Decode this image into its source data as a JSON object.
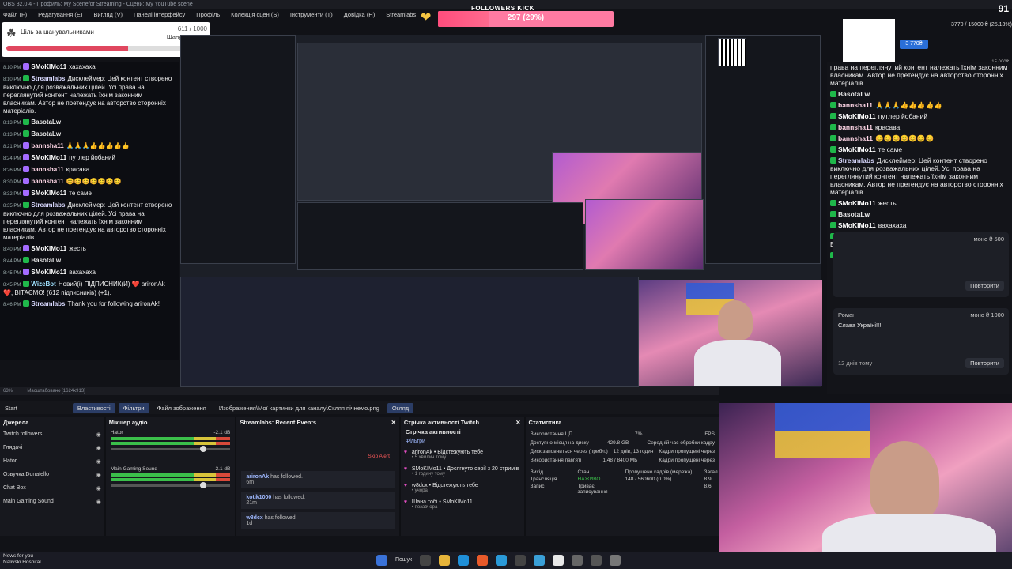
{
  "obs": {
    "title": "OBS 32.0.4 - Профиль: My Scenefor Streaming - Сцени: My YouTube scene",
    "menu": [
      "Файл (F)",
      "Редагування (E)",
      "Вигляд (V)",
      "Панелі інтерфейсу",
      "Профіль",
      "Колекція сцен (S)",
      "Інструменти (T)",
      "Довідка (H)",
      "Streamlabs"
    ],
    "status_left": "63%",
    "status_scale": "Масштабовано [1624x913]",
    "toolbar": {
      "start": "Start",
      "properties": "Властивості",
      "filters": "Фільтри",
      "image_file": "Файл зображення",
      "path": "Изображения\\Мої картинки для каналу\\Скляп пічнемо.png",
      "view": "Огляд"
    },
    "sources": {
      "title": "Джерела",
      "items": [
        "Twitch followers",
        "Глядачі",
        "Hator",
        "Озвучка Donatello",
        "Chat Box",
        "Main Gaming Sound"
      ]
    },
    "mixer": {
      "title": "Мікшер аудіо",
      "channels": [
        {
          "name": "Hator",
          "db": "-2.1 dB",
          "level": 0.75
        },
        {
          "name": "Main Gaming Sound",
          "db": "-2.1 dB",
          "level": 0.75
        }
      ]
    },
    "recent_events": {
      "title": "Streamlabs: Recent Events",
      "skip": "Skip Alert",
      "items": [
        {
          "name": "arironAk",
          "text": "has followed.",
          "ago": "6m"
        },
        {
          "name": "kotik1000",
          "text": "has followed.",
          "ago": "21m"
        },
        {
          "name": "w8dcx",
          "text": "has followed.",
          "ago": "1d"
        }
      ]
    },
    "activity": {
      "title": "Стрічка активності Twitch",
      "subtitle": "Стрічка активності",
      "filters": "Фільтри",
      "items": [
        {
          "text": "arironAk • Відстежують тебе",
          "sub": "• 5 хвилин тому"
        },
        {
          "text": "SMoKIMo11 • Досягнуто серії з 20 стримів",
          "sub": "• 1 годину тому"
        },
        {
          "text": "w8dcx • Відстежують тебе",
          "sub": "• учора"
        },
        {
          "text": "Шана тобі • SMoKIMo11",
          "sub": "• позавчора"
        }
      ]
    },
    "stats": {
      "title": "Статистика",
      "rows": [
        {
          "k": "Використання ЦП",
          "v": "7%",
          "k2": "FPS"
        },
        {
          "k": "Доступно місця на диску",
          "v": "429.8 GB",
          "k2": "Середній час обробки кадру"
        },
        {
          "k": "Диск заповниться через (прибл.)",
          "v": "12 днів, 13 годин",
          "k2": "Кадри пропущені через"
        },
        {
          "k": "Використання пам'яті",
          "v": "1.48 / 8400 МБ",
          "k2": "Кадри пропущені через"
        }
      ],
      "grid_headers": [
        "Вихід",
        "Стан",
        "Пропущено кадрів (мережа)",
        "Загал"
      ],
      "grid_rows": [
        [
          "Трансляція",
          "НАЖИВО",
          "148 / 560600 (0.0%)",
          "8.9"
        ],
        [
          "Запис",
          "Триває записування",
          "",
          "8.6"
        ]
      ]
    }
  },
  "goal": {
    "title": "Ціль за шанувальниками",
    "count": "611 / 1000",
    "sub": "Шанувальники",
    "progress": 0.611
  },
  "kick": {
    "label": "FOLLOWERS KICK",
    "value": "297 (29%)",
    "progress": 0.29
  },
  "donate": {
    "text": "3770 / 15000 ₴ (25.13%)",
    "button": "3 770₴",
    "max": "15 000₴",
    "score": "91"
  },
  "chat_left": [
    {
      "time": "8:10 PM",
      "name": "SMoKIMo11",
      "cls": "smo",
      "badge": "p",
      "text": "хахахаха"
    },
    {
      "time": "8:10 PM",
      "name": "Streamlabs",
      "cls": "sl",
      "badge": "g",
      "text": "Дисклеймер: Цей контент створено виключно для розважальних цілей. Усі права на переглянутий контент належать їхнім законним власникам. Автор не претендує на авторство сторонніх матеріалів."
    },
    {
      "time": "8:13 PM",
      "name": "BasotaLw",
      "cls": "basota",
      "badge": "g",
      "text": ""
    },
    {
      "time": "8:13 PM",
      "name": "BasotaLw",
      "cls": "basota",
      "badge": "g",
      "text": ""
    },
    {
      "time": "8:21 PM",
      "name": "bannsha11",
      "cls": "bann",
      "badge": "p",
      "text": "🙏🙏🙏👍👍👍👍👍"
    },
    {
      "time": "8:24 PM",
      "name": "SMoKIMo11",
      "cls": "smo",
      "badge": "p",
      "text": "путлер йобаний"
    },
    {
      "time": "8:26 PM",
      "name": "bannsha11",
      "cls": "bann",
      "badge": "p",
      "text": "красава"
    },
    {
      "time": "8:30 PM",
      "name": "bannsha11",
      "cls": "bann",
      "badge": "p",
      "text": "😊😊😊😊😊😊😊"
    },
    {
      "time": "8:32 PM",
      "name": "SMoKIMo11",
      "cls": "smo",
      "badge": "p",
      "text": "те саме"
    },
    {
      "time": "8:35 PM",
      "name": "Streamlabs",
      "cls": "sl",
      "badge": "g",
      "text": "Дисклеймер: Цей контент створено виключно для розважальних цілей. Усі права на переглянутий контент належать їхнім законним власникам. Автор не претендує на авторство сторонніх матеріалів."
    },
    {
      "time": "8:40 PM",
      "name": "SMoKIMo11",
      "cls": "smo",
      "badge": "p",
      "text": "жесть"
    },
    {
      "time": "8:44 PM",
      "name": "BasotaLw",
      "cls": "basota",
      "badge": "g",
      "text": ""
    },
    {
      "time": "8:45 PM",
      "name": "SMoKIMo11",
      "cls": "smo",
      "badge": "p",
      "text": "вахахаха"
    },
    {
      "time": "8:45 PM",
      "name": "WizeBot",
      "cls": "wize",
      "badge": "g",
      "text": "Новий(і) ПІДПИСНИК(И) ❤️ arironAk ❤️, ВІТАЄМО! (612 підписників) (+1)."
    },
    {
      "time": "8:46 PM",
      "name": "Streamlabs",
      "cls": "sl",
      "badge": "g",
      "text": "Thank you for following arironAk!"
    }
  ],
  "chat_right": [
    {
      "name": "",
      "cls": "sl",
      "text": "права на переглянутий контент належать їхнім законним власникам. Автор не претендує на авторство сторонніх матеріалів."
    },
    {
      "name": "BasotaLw",
      "cls": "basota",
      "text": ""
    },
    {
      "name": "bannsha11",
      "cls": "bann",
      "text": "🙏🙏🙏👍👍👍👍👍"
    },
    {
      "name": "SMoKIMo11",
      "cls": "smo",
      "text": "путлер йобаний"
    },
    {
      "name": "bannsha11",
      "cls": "bann",
      "text": "красава"
    },
    {
      "name": "bannsha11",
      "cls": "bann",
      "text": "😊😊😊😊😊😊😊"
    },
    {
      "name": "SMoKIMo11",
      "cls": "smo",
      "text": "те саме"
    },
    {
      "name": "Streamlabs",
      "cls": "sl",
      "text": "Дисклеймер: Цей контент створено виключно для розважальних цілей. Усі права на переглянутий контент належать їхнім законним власникам. Автор не претендує на авторство сторонніх матеріалів."
    },
    {
      "name": "SMoKIMo11",
      "cls": "smo",
      "text": "жесть"
    },
    {
      "name": "BasotaLw",
      "cls": "basota",
      "text": ""
    },
    {
      "name": "SMoKIMo11",
      "cls": "smo",
      "text": "вахахаха"
    },
    {
      "name": "WizeBot",
      "cls": "wize",
      "text": "Новий(і) ПІДПИСНИК(И) ❤️ arironAk ❤️, ВІТАЄМО! (612 підписників) (+1)."
    },
    {
      "name": "Streamlabs",
      "cls": "sl",
      "text": "Thank you for following arironAk!"
    }
  ],
  "donation_cards": [
    {
      "name": "",
      "amount": "моно ₴ 500",
      "message": "",
      "ago": "",
      "reply": "Повторити"
    },
    {
      "name": "Роман",
      "amount": "моно ₴ 1000",
      "message": "Слава Україні!!!",
      "ago": "12 днів тому",
      "reply": "Повторити"
    }
  ],
  "taskbar": {
    "news_title": "News for you",
    "news_sub": "Nalivski Hospital...",
    "search": "Пошук"
  }
}
